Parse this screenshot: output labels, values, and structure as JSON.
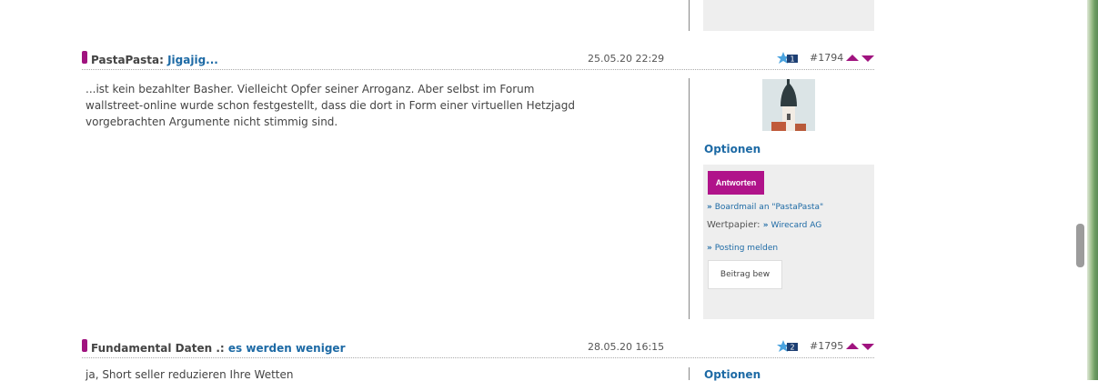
{
  "posts": [
    {
      "author": "PastaPasta",
      "separator": ":",
      "title": "Jigajig...",
      "date": "25.05.20 22:29",
      "rating": "1",
      "number": "#1794",
      "body": "...ist kein bezahlter Basher. Vielleicht Opfer seiner Arroganz. Aber selbst im Forum wallstreet-online wurde schon festgestellt, dass die dort in Form einer virtuellen Hetzjagd vorgebrachten Argumente nicht stimmig sind.",
      "options_label": "Optionen",
      "reply_label": "Antworten",
      "boardmail_label": "Boardmail an \"PastaPasta\"",
      "security_label": "Wertpapier:",
      "security_value": "Wirecard AG",
      "report_label": "Posting melden",
      "edit_label": "Beitrag bew"
    },
    {
      "author": "Fundamental Daten",
      "separator": ".:",
      "title": "es werden weniger",
      "date": "28.05.20 16:15",
      "rating": "2",
      "number": "#1795",
      "body": "ja, Short seller reduzieren Ihre Wetten",
      "options_label": "Optionen"
    }
  ],
  "colors": {
    "accent": "#a0137f",
    "link": "#1d6aa5",
    "sidebar_bg": "#eeeeee"
  },
  "icons": [
    "star-rating-icon",
    "vote-up-icon",
    "vote-down-icon",
    "chevron-right-icon"
  ]
}
